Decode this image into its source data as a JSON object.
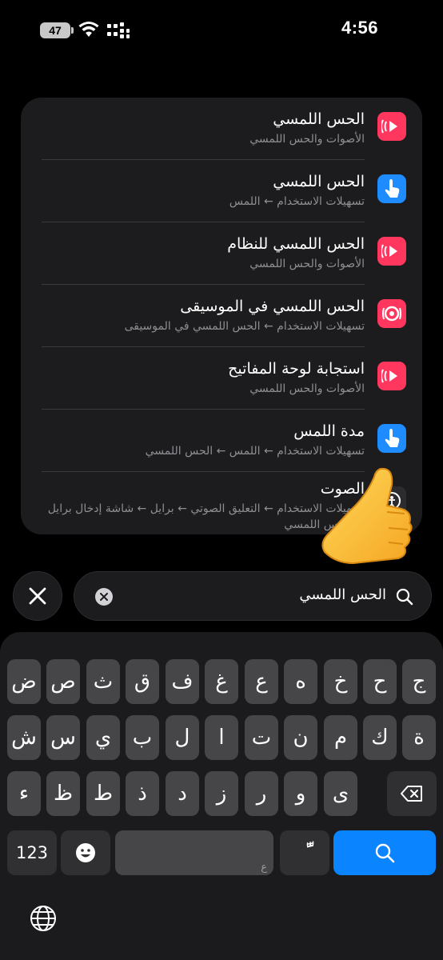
{
  "status_bar": {
    "battery": "47",
    "time": "4:56"
  },
  "results": [
    {
      "title": "الحس اللمسي",
      "subtitle": "الأصوات والحس اللمسي",
      "icon": "sounds-haptics-icon",
      "color": "#ff375f"
    },
    {
      "title": "الحس اللمسي",
      "subtitle": "تسهيلات الاستخدام ← اللمس",
      "icon": "touch-hand-icon",
      "color": "#1e8cff"
    },
    {
      "title": "الحس اللمسي للنظام",
      "subtitle": "الأصوات والحس اللمسي",
      "icon": "sounds-haptics-icon",
      "color": "#ff375f"
    },
    {
      "title": "الحس اللمسي في الموسيقى",
      "subtitle": "تسهيلات الاستخدام ← الحس اللمسي في الموسيقى",
      "icon": "music-haptics-icon",
      "color": "#ff375f"
    },
    {
      "title": "استجابة لوحة المفاتيح",
      "subtitle": "الأصوات والحس اللمسي",
      "icon": "sounds-haptics-icon",
      "color": "#ff375f"
    },
    {
      "title": "مدة اللمس",
      "subtitle": "تسهيلات الاستخدام ← اللمس ← الحس اللمسي",
      "icon": "touch-hand-icon",
      "color": "#1e8cff"
    },
    {
      "title": "الصوت",
      "subtitle": "تسهيلات الاستخدام ← التعليق الصوتي ← برايل ← شاشة إدخال برايل",
      "subtitle2": "← الحس اللمسي",
      "icon": "voiceover-icon",
      "color": "#1c1c1e"
    }
  ],
  "search": {
    "query": "الحس اللمسي",
    "cancel_icon": "close-icon",
    "clear_icon": "clear-icon",
    "search_icon": "search-icon"
  },
  "keyboard": {
    "row1": [
      "ض",
      "ص",
      "ث",
      "ق",
      "ف",
      "غ",
      "ع",
      "ه",
      "خ",
      "ح",
      "ج"
    ],
    "row2": [
      "ش",
      "س",
      "ي",
      "ب",
      "ل",
      "ا",
      "ت",
      "ن",
      "م",
      "ك",
      "ة"
    ],
    "row3": [
      "ء",
      "ظ",
      "ط",
      "ذ",
      "د",
      "ز",
      "ر",
      "و",
      "ى"
    ],
    "numbers_key": "123",
    "emoji_icon": "emoji-icon",
    "space_hint": "ع",
    "diacritic_key": "ًّ",
    "search_key_icon": "search-icon",
    "globe_icon": "globe-icon",
    "delete_icon": "backspace-icon"
  }
}
